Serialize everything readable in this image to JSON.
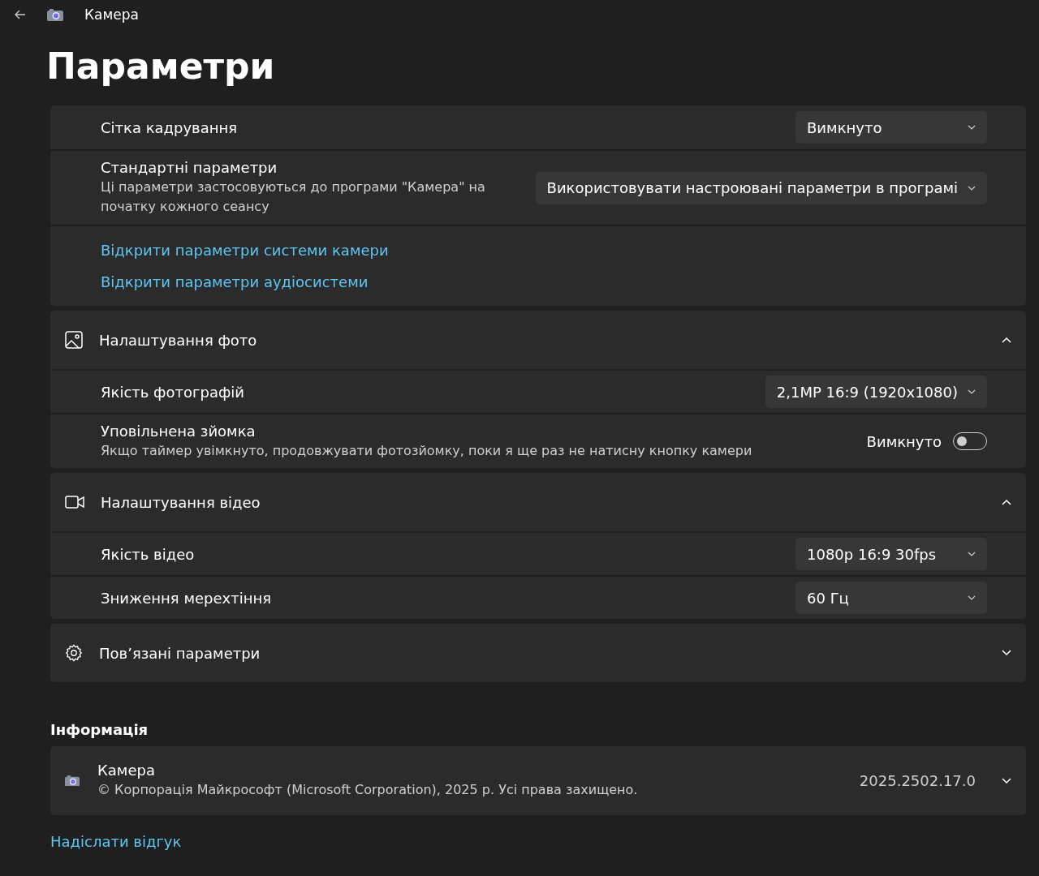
{
  "header": {
    "app_title": "Камера"
  },
  "page_title": "Параметри",
  "general": {
    "rows": [
      {
        "kind": "dropdown",
        "label": "Сітка кадрування",
        "value": "Вимкнуто"
      },
      {
        "kind": "dropdown",
        "label": "Стандартні параметри",
        "description": "Ці параметри застосовуються до програми \"Камера\" на початку кожного сеансу",
        "value": "Використовувати настроювані параметри в програмі"
      },
      {
        "kind": "links",
        "links": [
          "Відкрити параметри системи камери",
          "Відкрити параметри аудіосистеми"
        ]
      }
    ]
  },
  "sections": [
    {
      "kind": "photo",
      "title": "Налаштування фото",
      "expanded": true,
      "rows": [
        {
          "kind": "dropdown",
          "label": "Якість фотографій",
          "value": "2,1MP 16:9 (1920x1080)"
        },
        {
          "kind": "toggle",
          "label": "Уповільнена зйомка",
          "description": "Якщо таймер увімкнуто, продовжувати фотозйомку, поки я ще раз не натисну кнопку камери",
          "state_text": "Вимкнуто",
          "on": false
        }
      ]
    },
    {
      "kind": "video",
      "title": "Налаштування відео",
      "expanded": true,
      "rows": [
        {
          "kind": "dropdown",
          "label": "Якість відео",
          "value": "1080p 16:9 30fps"
        },
        {
          "kind": "dropdown",
          "label": "Зниження мерехтіння",
          "value": "60 Гц"
        }
      ]
    },
    {
      "kind": "gear",
      "title": "Пов’язані параметри",
      "expanded": false
    }
  ],
  "info": {
    "heading": "Інформація",
    "name": "Камера",
    "copyright": "© Корпорація Майкрософт (Microsoft Corporation), 2025 р. Усі права захищено.",
    "version": "2025.2502.17.0",
    "expanded": false
  },
  "feedback_link": "Надіслати відгук"
}
